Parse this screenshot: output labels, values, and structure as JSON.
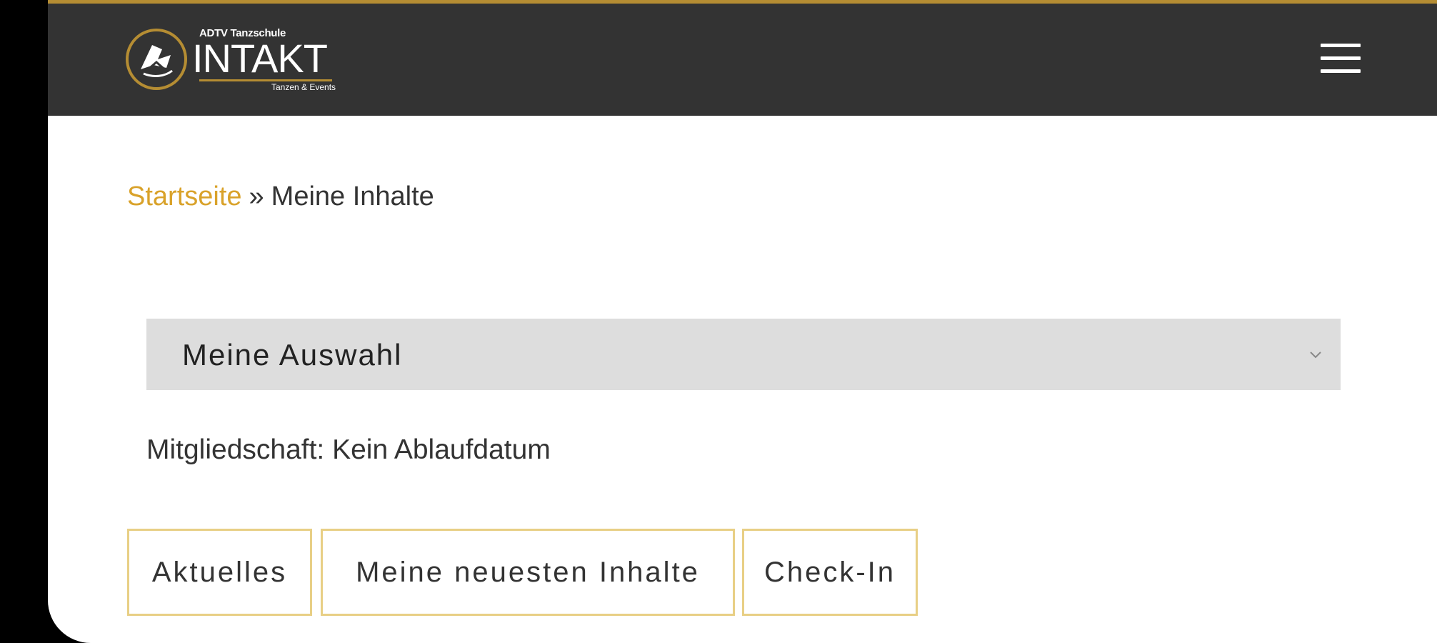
{
  "colors": {
    "accent_gold": "#b58d33",
    "link_gold": "#d9a22a",
    "header_bg": "#333333",
    "button_border": "#e8cf85",
    "select_bg": "#dddddd"
  },
  "header": {
    "logo": {
      "small_text": "ADTV Tanzschule",
      "brand": "INTAKT",
      "tagline": "Tanzen & Events",
      "emblem_icon": "dancers-emblem-icon"
    },
    "menu_icon": "hamburger-menu-icon"
  },
  "breadcrumb": {
    "home_label": "Startseite",
    "separator": "»",
    "current_label": "Meine Inhalte"
  },
  "content_select": {
    "selected_value": "Meine Auswahl",
    "icon": "chevron-down-icon"
  },
  "membership_text": "Mitgliedschaft: Kein Ablaufdatum",
  "buttons": [
    {
      "label": "Aktuelles"
    },
    {
      "label": "Meine neuesten Inhalte"
    },
    {
      "label": "Check-In"
    }
  ]
}
